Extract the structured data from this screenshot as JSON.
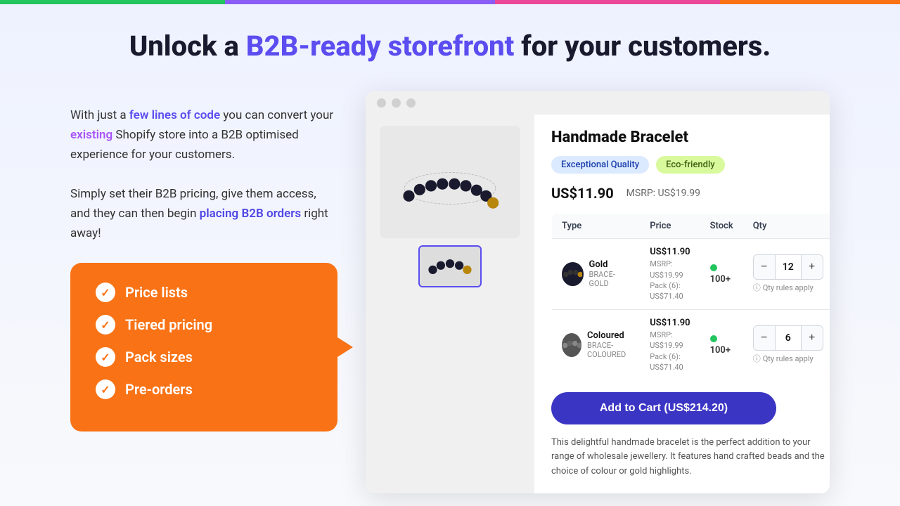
{
  "topBar": {
    "segments": [
      {
        "color": "#22c55e",
        "flex": 25
      },
      {
        "color": "#8b5cf6",
        "flex": 30
      },
      {
        "color": "#ec4899",
        "flex": 25
      },
      {
        "color": "#f97316",
        "flex": 20
      }
    ]
  },
  "hero": {
    "title_prefix": "Unlock a ",
    "title_highlight": "B2B-ready storefront",
    "title_suffix": " for your customers."
  },
  "leftText": {
    "paragraph1_prefix": "With just a ",
    "paragraph1_link1": "few lines of code",
    "paragraph1_middle": " you can convert your ",
    "paragraph1_link2": "existing",
    "paragraph1_suffix": " Shopify store into a B2B optimised experience for your customers.",
    "paragraph2_prefix": "Simply set their B2B pricing, give them access, and they can then begin ",
    "paragraph2_link": "placing B2B orders",
    "paragraph2_suffix": " right away!"
  },
  "featuresBox": {
    "items": [
      "Price lists",
      "Tiered pricing",
      "Pack sizes",
      "Pre-orders"
    ]
  },
  "product": {
    "name": "Handmade Bracelet",
    "badges": [
      "Exceptional Quality",
      "Eco-friendly"
    ],
    "price": "US$11.90",
    "msrp": "MSRP: US$19.99",
    "table": {
      "headers": [
        "Type",
        "Price",
        "Stock",
        "Qty"
      ],
      "rows": [
        {
          "type_name": "Gold",
          "type_sku": "BRACE-GOLD",
          "price_main": "US$11.90",
          "price_msrp": "MSRP: US$19.99",
          "price_pack": "Pack (6): US$71.40",
          "stock": "100+",
          "qty": 12,
          "qty_note": "Qty rules apply"
        },
        {
          "type_name": "Coloured",
          "type_sku": "BRACE-COLOURED",
          "price_main": "US$11.90",
          "price_msrp": "MSRP: US$19.99",
          "price_pack": "Pack (6): US$71.40",
          "stock": "100+",
          "qty": 6,
          "qty_note": "Qty rules apply"
        }
      ]
    },
    "add_to_cart": "Add to Cart (US$214.20)",
    "description": "This delightful handmade bracelet is the perfect addition to your range of wholesale jewellery. It features hand crafted beads and the choice of colour or gold highlights."
  }
}
